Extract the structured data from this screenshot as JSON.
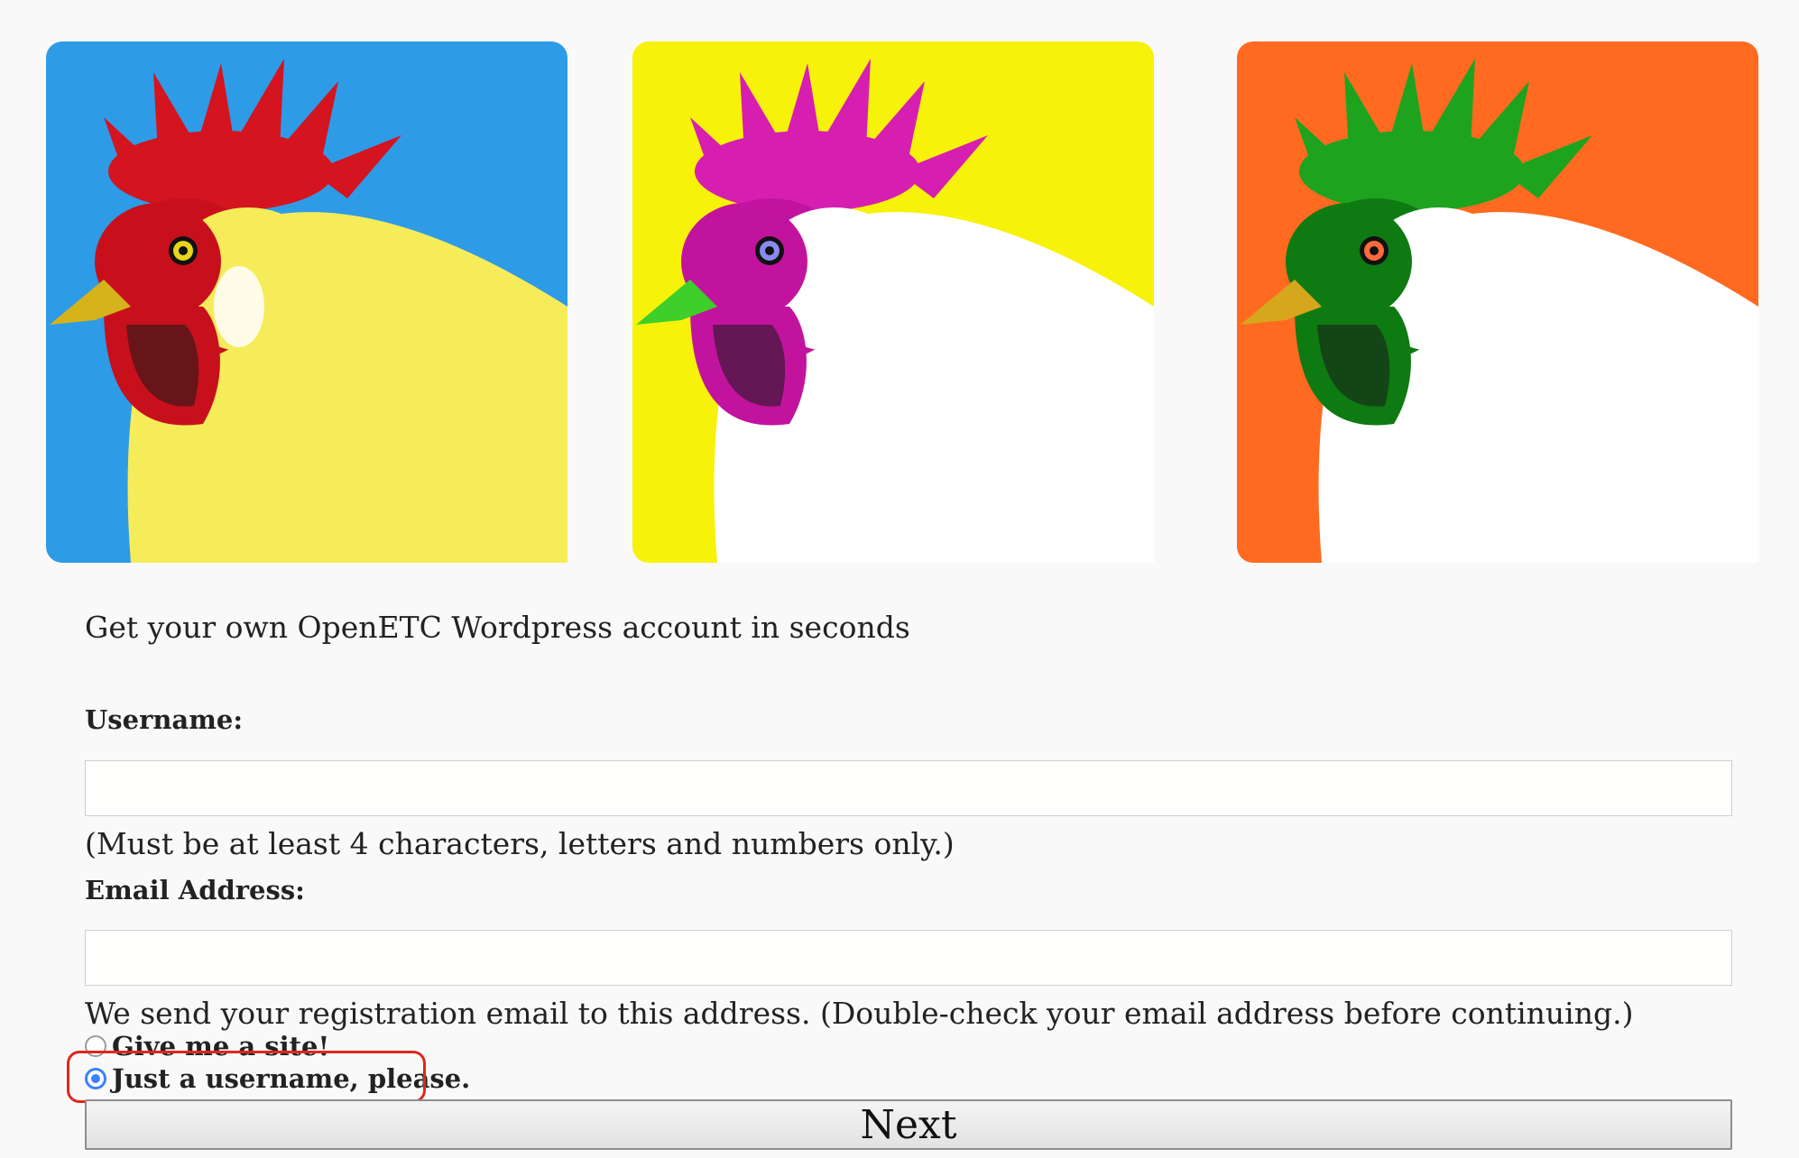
{
  "banner": {
    "tiles": [
      {
        "background": "#2e9be6",
        "comb": "#d4141e",
        "face": "#c8101c",
        "beak": "#d6b31a",
        "body": "#f6ec5a",
        "eye": "#e8d41a"
      },
      {
        "background": "#f7f20a",
        "comb": "#d61fb0",
        "face": "#c2139e",
        "beak": "#3fcf2a",
        "body": "#ffffff",
        "eye": "#8a8af0"
      },
      {
        "background": "#ff6a20",
        "comb": "#1ea31e",
        "face": "#0e7a12",
        "beak": "#d6a61c",
        "body": "#ffffff",
        "eye": "#ff6a3a"
      }
    ]
  },
  "form": {
    "intro": "Get your own OpenETC Wordpress account in seconds",
    "username": {
      "label": "Username:",
      "value": "",
      "hint": "(Must be at least 4 characters, letters and numbers only.)"
    },
    "email": {
      "label": "Email Address:",
      "value": "",
      "hint": "We send your registration email to this address. (Double-check your email address before continuing.)"
    },
    "options": {
      "site_label": "Give me a site!",
      "site_checked": false,
      "username_only_label": "Just a username, please.",
      "username_only_checked": true
    },
    "next_label": "Next"
  },
  "colors": {
    "radio_accent": "#3b82f6",
    "highlight": "#e0271b"
  }
}
